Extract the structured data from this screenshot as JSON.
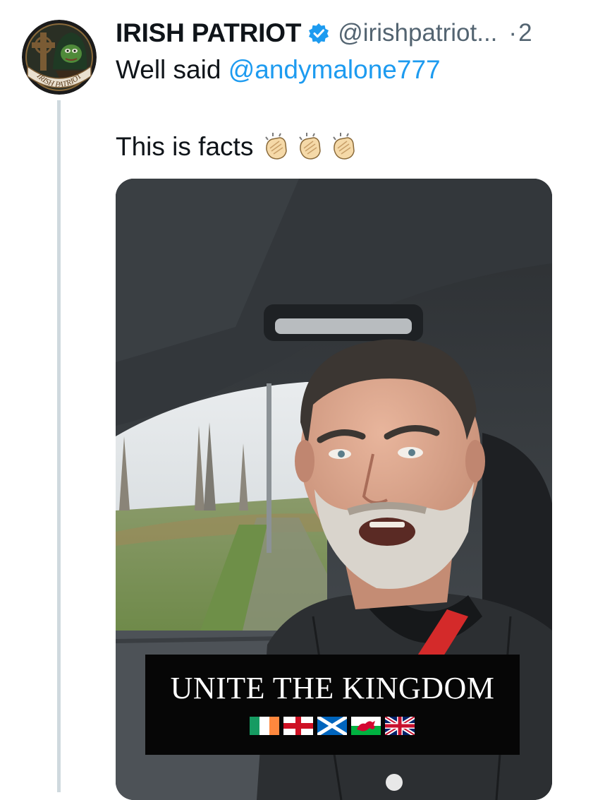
{
  "tweet": {
    "author": {
      "display_name": "IRISH PATRIOT",
      "handle": "@irishpatriot...",
      "separator": "·",
      "time": "2",
      "avatar_text": "IRISH PATRIOT",
      "verified": true
    },
    "text_line1_prefix": "Well said ",
    "mention": "@andymalone777",
    "text_line2": "This is facts",
    "emoji": [
      "clapping-hands",
      "clapping-hands",
      "clapping-hands"
    ],
    "media": {
      "type": "video",
      "caption": "UNITE THE KINGDOM",
      "flags": [
        "ireland-flag",
        "england-flag",
        "scotland-flag",
        "wales-flag",
        "union-jack-flag"
      ]
    }
  },
  "colors": {
    "link": "#1d9bf0",
    "verified_badge": "#1d9bf0",
    "secondary_text": "#536471",
    "primary_text": "#0f1419",
    "thread_line": "#cfd9de"
  }
}
